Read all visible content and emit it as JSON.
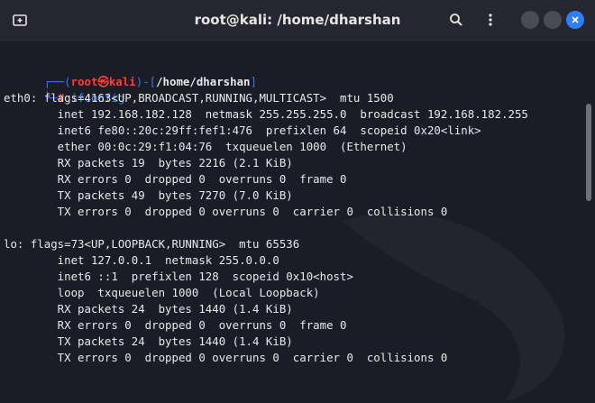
{
  "window": {
    "title": "root@kali: /home/dharshan",
    "accent": "#2f7df6"
  },
  "icons": {
    "new_tab": "new-tab-icon",
    "search": "search-icon",
    "menu": "kebab-menu-icon",
    "minimize": "minimize-icon",
    "maximize": "maximize-icon",
    "close": "close-icon"
  },
  "terminal": {
    "prompt": {
      "top_left": "┌──(",
      "user": "root",
      "at": "㉿",
      "host": "kali",
      "mid": ")-[",
      "path": "/home/dharshan",
      "end": "]",
      "bottom_left": "└─",
      "hash": "#",
      "command": "ifconfig"
    },
    "output": [
      "eth0: flags=4163<UP,BROADCAST,RUNNING,MULTICAST>  mtu 1500",
      "        inet 192.168.182.128  netmask 255.255.255.0  broadcast 192.168.182.255",
      "        inet6 fe80::20c:29ff:fef1:476  prefixlen 64  scopeid 0x20<link>",
      "        ether 00:0c:29:f1:04:76  txqueuelen 1000  (Ethernet)",
      "        RX packets 19  bytes 2216 (2.1 KiB)",
      "        RX errors 0  dropped 0  overruns 0  frame 0",
      "        TX packets 49  bytes 7270 (7.0 KiB)",
      "        TX errors 0  dropped 0 overruns 0  carrier 0  collisions 0",
      "",
      "lo: flags=73<UP,LOOPBACK,RUNNING>  mtu 65536",
      "        inet 127.0.0.1  netmask 255.0.0.0",
      "        inet6 ::1  prefixlen 128  scopeid 0x10<host>",
      "        loop  txqueuelen 1000  (Local Loopback)",
      "        RX packets 24  bytes 1440 (1.4 KiB)",
      "        RX errors 0  dropped 0  overruns 0  frame 0",
      "        TX packets 24  bytes 1440 (1.4 KiB)",
      "        TX errors 0  dropped 0 overruns 0  carrier 0  collisions 0"
    ]
  }
}
